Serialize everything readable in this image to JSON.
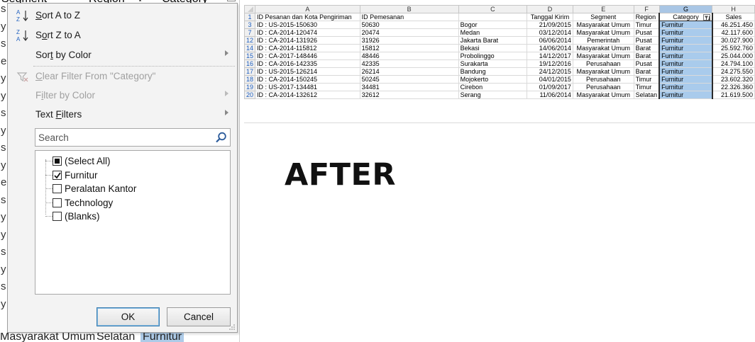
{
  "background_peek": {
    "header": [
      "Segment",
      "Region",
      "Category"
    ],
    "left_col_chars": [
      "s",
      "y",
      "s",
      "e",
      "y",
      "y",
      "s",
      "y",
      "s",
      "y",
      "e",
      "s",
      "y",
      "y",
      "s",
      "y",
      "s",
      "y"
    ],
    "bottom_row": [
      "Masyarakat Umum",
      "Selatan",
      "Furnitur"
    ]
  },
  "filter_menu": {
    "sort_az": "Sort A to Z",
    "sort_za": "Sort Z to A",
    "sort_color": "Sort by Color",
    "clear_filter": "Clear Filter From \"Category\"",
    "filter_color": "Filter by Color",
    "text_filters": "Text Filters",
    "search_placeholder": "Search",
    "items": [
      {
        "label": "(Select All)",
        "state": "partial"
      },
      {
        "label": "Furnitur",
        "state": "checked"
      },
      {
        "label": "Peralatan Kantor",
        "state": "unchecked"
      },
      {
        "label": "Technology",
        "state": "unchecked"
      },
      {
        "label": "(Blanks)",
        "state": "unchecked"
      }
    ],
    "ok_label": "OK",
    "cancel_label": "Cancel"
  },
  "annotation": "AFTER",
  "sheet": {
    "col_letters": [
      "A",
      "B",
      "C",
      "D",
      "E",
      "F",
      "G",
      "H"
    ],
    "header_row": {
      "num": "1",
      "cells": [
        "ID Pesanan dan Kota Pengiriman",
        "ID Pemesanan",
        "",
        "Tanggal Kirim",
        "Segment",
        "Region",
        "Category",
        "Sales"
      ]
    },
    "rows": [
      {
        "num": "3",
        "cells": [
          "ID : US-2015-150630",
          "50630",
          "Bogor",
          "21/09/2015",
          "Masyarakat Umum",
          "Timur",
          "Furnitur",
          "46.251.450"
        ]
      },
      {
        "num": "7",
        "cells": [
          "ID : CA-2014-120474",
          "20474",
          "Medan",
          "03/12/2014",
          "Masyarakat Umum",
          "Pusat",
          "Furnitur",
          "42.117.600"
        ]
      },
      {
        "num": "12",
        "cells": [
          "ID : CA-2014-131926",
          "31926",
          "Jakarta Barat",
          "06/06/2014",
          "Pemerintah",
          "Pusat",
          "Furnitur",
          "30.027.900"
        ]
      },
      {
        "num": "14",
        "cells": [
          "ID : CA-2014-115812",
          "15812",
          "Bekasi",
          "14/06/2014",
          "Masyarakat Umum",
          "Barat",
          "Furnitur",
          "25.592.760"
        ]
      },
      {
        "num": "15",
        "cells": [
          "ID : CA-2017-148446",
          "48446",
          "Probolinggo",
          "14/12/2017",
          "Masyarakat Umum",
          "Barat",
          "Furnitur",
          "25.044.000"
        ]
      },
      {
        "num": "16",
        "cells": [
          "ID : CA-2016-142335",
          "42335",
          "Surakarta",
          "19/12/2016",
          "Perusahaan",
          "Pusat",
          "Furnitur",
          "24.794.100"
        ]
      },
      {
        "num": "17",
        "cells": [
          "ID : US-2015-126214",
          "26214",
          "Bandung",
          "24/12/2015",
          "Masyarakat Umum",
          "Barat",
          "Furnitur",
          "24.275.550"
        ]
      },
      {
        "num": "18",
        "cells": [
          "ID : CA-2014-150245",
          "50245",
          "Mojokerto",
          "04/01/2015",
          "Perusahaan",
          "Timur",
          "Furnitur",
          "23.602.320"
        ]
      },
      {
        "num": "19",
        "cells": [
          "ID : US-2017-134481",
          "34481",
          "Cirebon",
          "01/09/2017",
          "Perusahaan",
          "Timur",
          "Furnitur",
          "22.326.360"
        ]
      },
      {
        "num": "20",
        "cells": [
          "ID : CA-2014-132612",
          "32612",
          "Serang",
          "11/06/2014",
          "Masyarakat Umum",
          "Selatan",
          "Furnitur",
          "21.619.500"
        ]
      }
    ]
  },
  "colors": {
    "selection": "#a9cbec",
    "row_number": "#1f5fbf",
    "ok_border": "#3c7fb1"
  }
}
